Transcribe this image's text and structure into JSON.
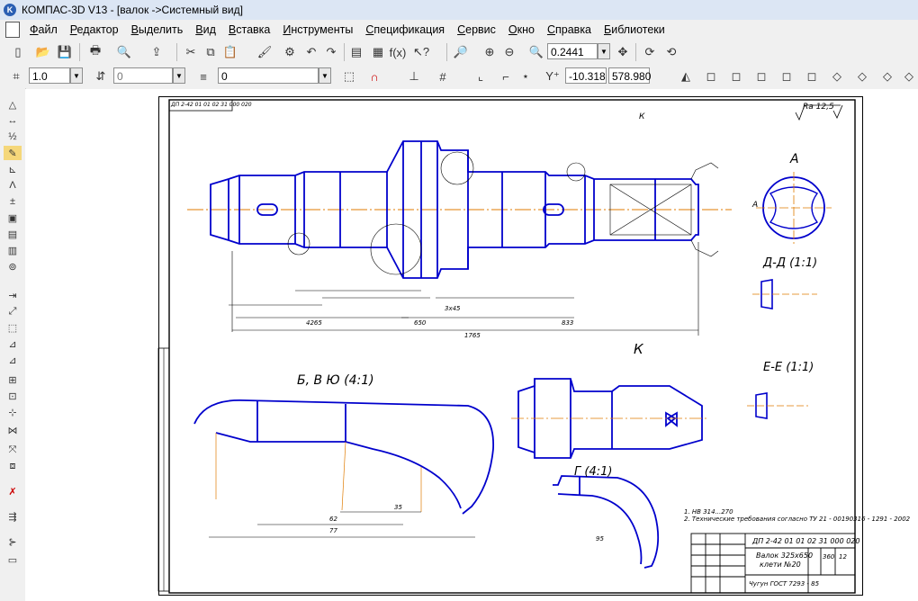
{
  "window": {
    "title": "КОМПАС-3D V13 - [валок ->Системный вид]"
  },
  "menu": [
    "Файл",
    "Редактор",
    "Выделить",
    "Вид",
    "Вставка",
    "Инструменты",
    "Спецификация",
    "Сервис",
    "Окно",
    "Справка",
    "Библиотеки"
  ],
  "toolbar": {
    "zoom_value": "0.2441"
  },
  "properties_bar": {
    "line_scale": "1.0",
    "step_value": "0",
    "layer_value": "0",
    "coord_x": "-10.318",
    "coord_y": "578.980"
  },
  "drawing": {
    "stamp_top_code": "ДП 2-42 01 01 02 31 000 020",
    "roughness": "Ra 12,5",
    "view_a": "А",
    "view_k": "К",
    "section_dd": "Д-Д (1:1)",
    "section_ee": "Е-Е (1:1)",
    "detail_bvyu": "Б, В Ю (4:1)",
    "detail_g": "Г (4:1)",
    "part_name_line1": "Валок 325х650",
    "part_name_line2": "клети №20",
    "material": "Чугун ГОСТ 7293 - 85",
    "sheet_num": "12",
    "mass_value": "360",
    "notes_line1": "1. НВ 314...270",
    "notes_line2": "2. Технические требования согласно ТУ 21 - 00190316 - 1291 - 2002",
    "dim_total": "1765",
    "dim_833": "833",
    "dim_4265": "4265",
    "dim_650": "650",
    "dim_77": "77",
    "dim_62": "62",
    "dim_95": "95",
    "dim_35": "35",
    "dim_315": "3х45"
  },
  "colors": {
    "drawing_blue": "#0000cc",
    "axis_orange": "#e07b00",
    "green_marker": "#00a050"
  }
}
